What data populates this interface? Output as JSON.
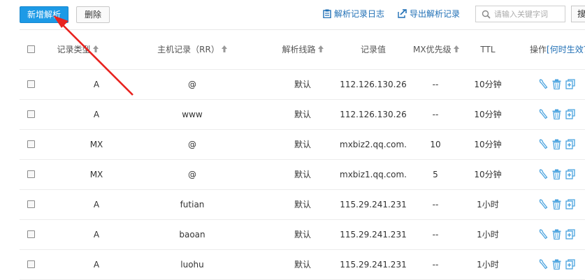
{
  "toolbar": {
    "add_label": "新增解析",
    "delete_label": "删除",
    "log_label": "解析记录日志",
    "export_label": "导出解析记录",
    "search_placeholder": "请输入关键字词",
    "search_button_label": "搜"
  },
  "table": {
    "headers": {
      "type": "记录类型",
      "host": "主机记录（RR）",
      "line": "解析线路",
      "value": "记录值",
      "mx": "MX优先级",
      "ttl": "TTL",
      "ops": "操作",
      "help": "[何时生效？"
    },
    "rows": [
      {
        "type": "A",
        "host": "@",
        "line": "默认",
        "value": "112.126.130.26",
        "mx": "--",
        "ttl": "10分钟"
      },
      {
        "type": "A",
        "host": "www",
        "line": "默认",
        "value": "112.126.130.26",
        "mx": "--",
        "ttl": "10分钟"
      },
      {
        "type": "MX",
        "host": "@",
        "line": "默认",
        "value": "mxbiz2.qq.com.",
        "mx": "10",
        "ttl": "10分钟"
      },
      {
        "type": "MX",
        "host": "@",
        "line": "默认",
        "value": "mxbiz1.qq.com.",
        "mx": "5",
        "ttl": "10分钟"
      },
      {
        "type": "A",
        "host": "futian",
        "line": "默认",
        "value": "115.29.241.231",
        "mx": "--",
        "ttl": "1小时"
      },
      {
        "type": "A",
        "host": "baoan",
        "line": "默认",
        "value": "115.29.241.231",
        "mx": "--",
        "ttl": "1小时"
      },
      {
        "type": "A",
        "host": "luohu",
        "line": "默认",
        "value": "115.29.241.231",
        "mx": "--",
        "ttl": "1小时"
      }
    ]
  },
  "colors": {
    "primary": "#1d9ae6",
    "link": "#1f6fb5",
    "icon": "#4aa3df",
    "annotation_arrow": "#e8231f"
  },
  "icons": [
    "clipboard-icon",
    "export-icon",
    "search-icon",
    "sort-up-icon",
    "wrench-icon",
    "trash-icon",
    "copy-add-icon"
  ]
}
